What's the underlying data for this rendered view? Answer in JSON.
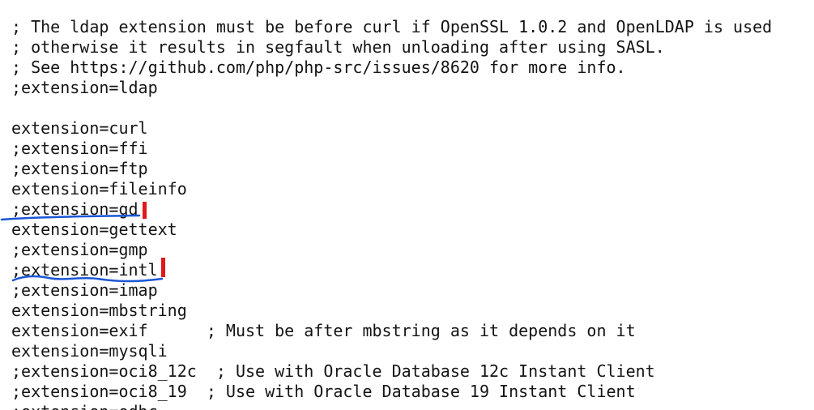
{
  "editor": {
    "lines": [
      "; The ldap extension must be before curl if OpenSSL 1.0.2 and OpenLDAP is used",
      "; otherwise it results in segfault when unloading after using SASL.",
      "; See https://github.com/php/php-src/issues/8620 for more info.",
      ";extension=ldap",
      "",
      "extension=curl",
      ";extension=ffi",
      ";extension=ftp",
      "extension=fileinfo",
      ";extension=gd",
      "extension=gettext",
      ";extension=gmp",
      ";extension=intl",
      ";extension=imap",
      "extension=mbstring",
      "extension=exif      ; Must be after mbstring as it depends on it",
      "extension=mysqli",
      ";extension=oci8_12c  ; Use with Oracle Database 12c Instant Client",
      ";extension=oci8_19  ; Use with Oracle Database 19 Instant Client",
      ";extension=odbc"
    ]
  },
  "annotations": {
    "underline_color": "#1a56d6",
    "marker_color": "#e0181b"
  }
}
